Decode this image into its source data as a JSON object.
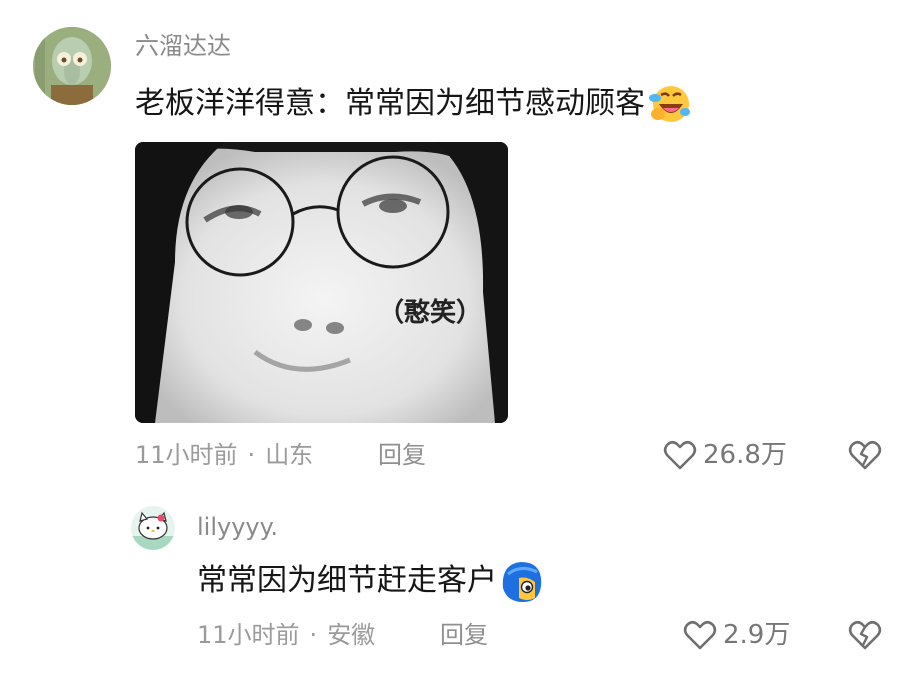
{
  "comments": [
    {
      "username": "六溜达达",
      "text": "老板洋洋得意：常常因为细节感动顾客",
      "emoji_icon": "laughing-crying-face-emoji",
      "image_caption": "（憨笑）",
      "time": "11小时前",
      "separator": "·",
      "location": "山东",
      "reply_label": "回复",
      "likes": "26.8万"
    }
  ],
  "replies": [
    {
      "username": "lilyyyy.",
      "text": "常常因为细节赶走客户",
      "emoji_icon": "blue-hair-peeking-face-emoji",
      "time": "11小时前",
      "separator": "·",
      "location": "安徽",
      "reply_label": "回复",
      "likes": "2.9万"
    }
  ],
  "colors": {
    "text_primary": "#161616",
    "text_secondary": "#8a8a8a",
    "background": "#ffffff"
  },
  "icons": {
    "like": "heart-outline-icon",
    "dislike": "broken-heart-icon"
  }
}
